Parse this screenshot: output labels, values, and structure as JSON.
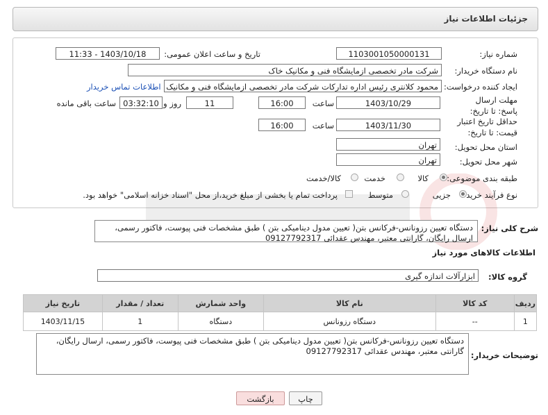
{
  "header": {
    "title": "جزئیات اطلاعات نیاز"
  },
  "form": {
    "need_number_label": "شماره نیاز:",
    "need_number": "1103001050000131",
    "announce_label": "تاریخ و ساعت اعلان عمومی:",
    "announce_value": "1403/10/18 - 11:33",
    "buyer_org_label": "نام دستگاه خریدار:",
    "buyer_org": "شرکت مادر تخصصی ازمایشگاه فنی و مکانیک خاک",
    "requester_label": "ایجاد کننده درخواست:",
    "requester": "محمود کلانتری رئیس اداره تدارکات شرکت مادر تخصصی ازمایشگاه فنی و مکانیک",
    "buyer_contact_link": "اطلاعات تماس خریدار",
    "deadline_label": "مهلت ارسال پاسخ: تا تاریخ:",
    "deadline_date": "1403/10/29",
    "time_label": "ساعت",
    "deadline_time": "16:00",
    "days_value": "11",
    "day_and_label": "روز و",
    "remaining_time": "03:32:10",
    "remaining_label": "ساعت باقی مانده",
    "validity_label": "حداقل تاریخ اعتبار قیمت: تا تاریخ:",
    "validity_date": "1403/11/30",
    "validity_time_label": "ساعت",
    "validity_time": "16:00",
    "province_label": "استان محل تحویل:",
    "province": "تهران",
    "city_label": "شهر محل تحویل:",
    "city": "تهران",
    "category_label": "طبقه بندی موضوعی:",
    "category_options": [
      "کالا",
      "خدمت",
      "کالا/خدمت"
    ],
    "category_selected": "کالا",
    "process_label": "نوع فرآیند خرید :",
    "process_options": [
      "جزیی",
      "متوسط"
    ],
    "process_selected": "جزیی",
    "payment_note": "پرداخت تمام یا بخشی از مبلغ خرید،از محل \"اسناد خزانه اسلامی\" خواهد بود."
  },
  "summary": {
    "label": "شرح کلی نیاز:",
    "text": "دستگاه تعیین رزونانس-فرکانس بتن( تعیین مدول دینامیکی بتن ) طبق مشخصات فنی پیوست، فاکتور رسمی، ارسال رایگان، گارانتی معتبر، مهندس عقدائی 09127792317"
  },
  "goods": {
    "section_title": "اطلاعات کالاهای مورد نیاز",
    "group_label": "گروه کالا:",
    "group_value": "ابزارآلات اندازه گیری",
    "columns": [
      "ردیف",
      "کد کالا",
      "نام کالا",
      "واحد شمارش",
      "تعداد / مقدار",
      "تاریخ نیاز"
    ],
    "rows": [
      [
        "1",
        "--",
        "دستگاه رزونانس",
        "دستگاه",
        "1",
        "1403/11/15"
      ]
    ]
  },
  "buyer_notes": {
    "label": "توضیحات خریدار:",
    "text": "دستگاه تعیین رزونانس-فرکانس بتن( تعیین مدول دینامیکی بتن ) طبق مشخصات فنی پیوست، فاکتور رسمی، ارسال رایگان، گارانتی معتبر، مهندس عقدائی 09127792317"
  },
  "buttons": {
    "print": "چاپ",
    "back": "بازگشت"
  },
  "colors": {
    "link": "#1a4fb5",
    "back_button_bg": "#f9dede",
    "header_gradient_top": "#f7f7f7"
  }
}
